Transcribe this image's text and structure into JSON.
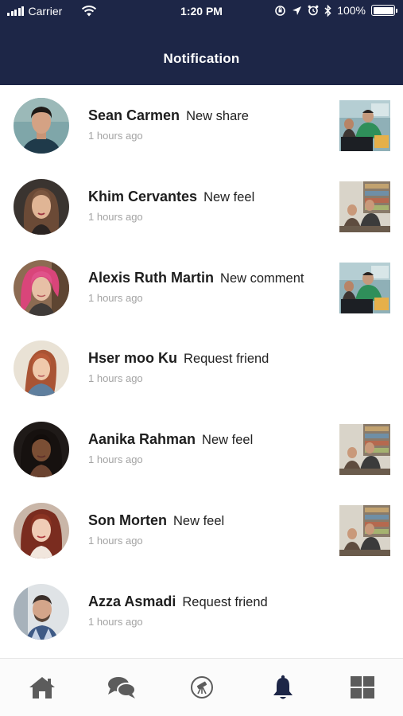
{
  "status_bar": {
    "carrier": "Carrier",
    "time": "1:20 PM",
    "battery": "100%"
  },
  "header": {
    "title": "Notification",
    "background": "#1d2647"
  },
  "notifications": [
    {
      "name": "Sean Carmen",
      "action": "New share",
      "time": "1 hours ago",
      "has_thumbnail": true
    },
    {
      "name": "Khim Cervantes",
      "action": "New feel",
      "time": "1 hours ago",
      "has_thumbnail": true
    },
    {
      "name": "Alexis Ruth Martin",
      "action": "New comment",
      "time": "1 hours ago",
      "has_thumbnail": true
    },
    {
      "name": "Hser moo Ku",
      "action": "Request friend",
      "time": "1 hours ago",
      "has_thumbnail": false
    },
    {
      "name": "Aanika Rahman",
      "action": "New feel",
      "time": "1 hours ago",
      "has_thumbnail": true
    },
    {
      "name": "Son Morten",
      "action": "New feel",
      "time": "1 hours ago",
      "has_thumbnail": true
    },
    {
      "name": "Azza Asmadi",
      "action": "Request friend",
      "time": "1 hours ago",
      "has_thumbnail": false
    }
  ],
  "tabbar": {
    "items": [
      {
        "icon": "home-icon",
        "active": false
      },
      {
        "icon": "chat-icon",
        "active": false
      },
      {
        "icon": "telescope-icon",
        "active": false
      },
      {
        "icon": "bell-icon",
        "active": true
      },
      {
        "icon": "grid-icon",
        "active": false
      }
    ],
    "active_color": "#1d2647",
    "inactive_color": "#5c5c5c"
  }
}
